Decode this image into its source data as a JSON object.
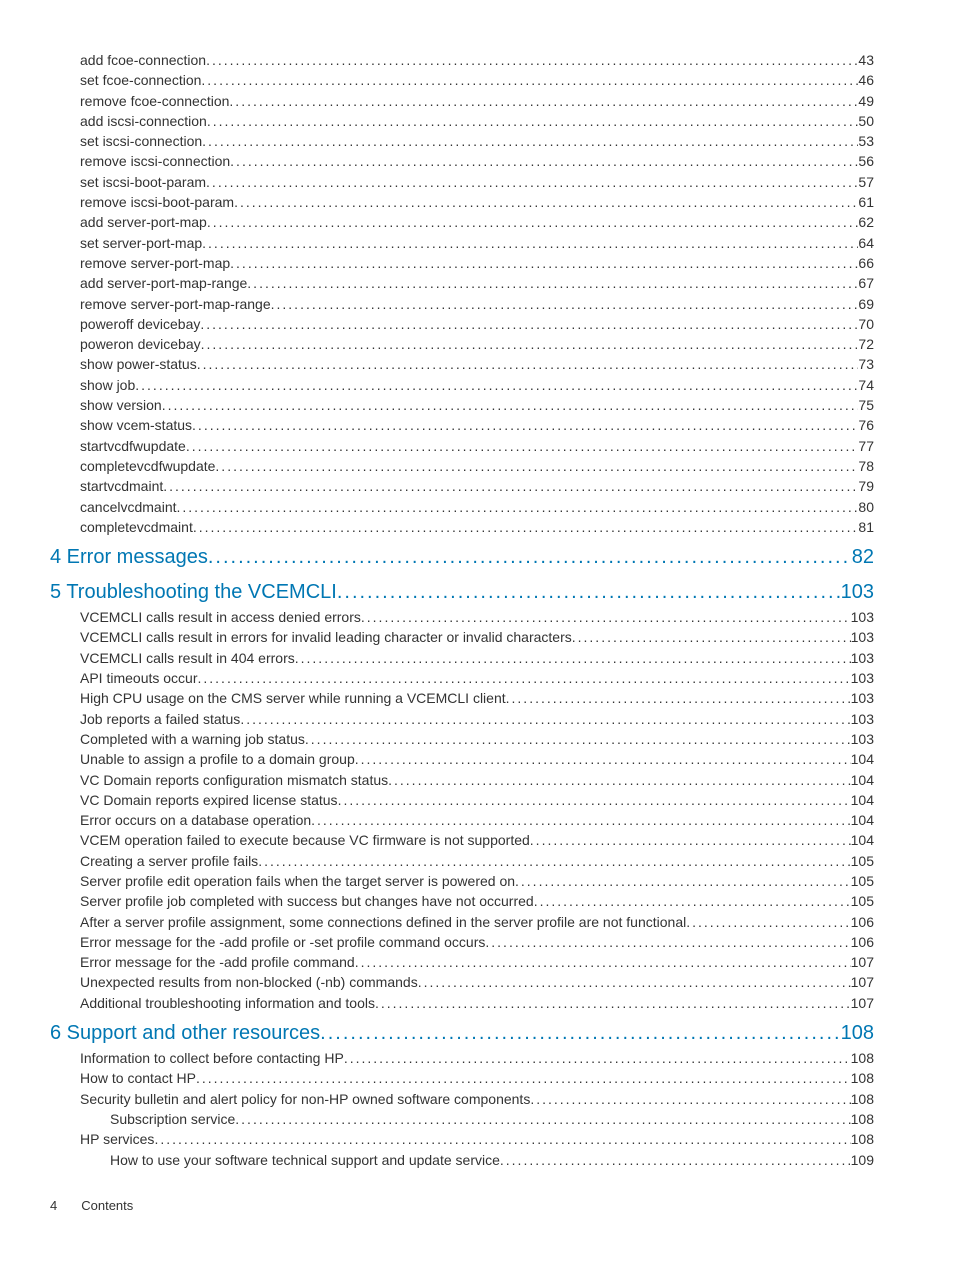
{
  "toc": [
    {
      "level": 1,
      "label": "add fcoe-connection",
      "page": "43"
    },
    {
      "level": 1,
      "label": "set fcoe-connection",
      "page": "46"
    },
    {
      "level": 1,
      "label": "remove fcoe-connection",
      "page": "49"
    },
    {
      "level": 1,
      "label": "add iscsi-connection",
      "page": "50"
    },
    {
      "level": 1,
      "label": "set iscsi-connection",
      "page": "53"
    },
    {
      "level": 1,
      "label": "remove iscsi-connection",
      "page": "56"
    },
    {
      "level": 1,
      "label": "set iscsi-boot-param",
      "page": "57"
    },
    {
      "level": 1,
      "label": "remove iscsi-boot-param",
      "page": "61"
    },
    {
      "level": 1,
      "label": "add server-port-map",
      "page": "62"
    },
    {
      "level": 1,
      "label": "set server-port-map",
      "page": "64"
    },
    {
      "level": 1,
      "label": "remove server-port-map",
      "page": "66"
    },
    {
      "level": 1,
      "label": "add server-port-map-range",
      "page": "67"
    },
    {
      "level": 1,
      "label": "remove server-port-map-range",
      "page": "69"
    },
    {
      "level": 1,
      "label": "poweroff devicebay",
      "page": "70"
    },
    {
      "level": 1,
      "label": "poweron devicebay",
      "page": "72"
    },
    {
      "level": 1,
      "label": "show power-status",
      "page": "73"
    },
    {
      "level": 1,
      "label": "show job",
      "page": "74"
    },
    {
      "level": 1,
      "label": "show version",
      "page": "75"
    },
    {
      "level": 1,
      "label": "show vcem-status",
      "page": "76"
    },
    {
      "level": 1,
      "label": "startvcdfwupdate",
      "page": "77"
    },
    {
      "level": 1,
      "label": "completevcdfwupdate",
      "page": "78"
    },
    {
      "level": 1,
      "label": "startvcdmaint",
      "page": "79"
    },
    {
      "level": 1,
      "label": "cancelvcdmaint",
      "page": "80"
    },
    {
      "level": 1,
      "label": "completevcdmaint",
      "page": "81"
    },
    {
      "level": 0,
      "label": "4 Error messages",
      "page": "82"
    },
    {
      "level": 0,
      "label": "5 Troubleshooting the VCEMCLI",
      "page": "103"
    },
    {
      "level": 1,
      "label": "VCEMCLI calls result in access denied errors",
      "page": "103"
    },
    {
      "level": 1,
      "label": "VCEMCLI calls result in errors for invalid leading character or invalid characters",
      "page": "103"
    },
    {
      "level": 1,
      "label": "VCEMCLI calls result in 404 errors",
      "page": "103"
    },
    {
      "level": 1,
      "label": "API timeouts occur",
      "page": "103"
    },
    {
      "level": 1,
      "label": "High CPU usage on the CMS server while running a VCEMCLI client",
      "page": "103"
    },
    {
      "level": 1,
      "label": "Job reports a failed status",
      "page": "103"
    },
    {
      "level": 1,
      "label": "Completed with a warning job status",
      "page": "103"
    },
    {
      "level": 1,
      "label": "Unable to assign a profile to a domain group",
      "page": "104"
    },
    {
      "level": 1,
      "label": "VC Domain reports configuration mismatch status",
      "page": "104"
    },
    {
      "level": 1,
      "label": "VC Domain reports expired license status",
      "page": "104"
    },
    {
      "level": 1,
      "label": "Error occurs on a database operation",
      "page": "104"
    },
    {
      "level": 1,
      "label": "VCEM operation failed to execute because VC firmware is not supported",
      "page": "104"
    },
    {
      "level": 1,
      "label": "Creating a server profile fails",
      "page": "105"
    },
    {
      "level": 1,
      "label": "Server profile edit operation fails when the target server is powered on",
      "page": "105"
    },
    {
      "level": 1,
      "label": "Server profile job completed with success but changes have not occurred",
      "page": "105"
    },
    {
      "level": 1,
      "label": "After a server profile assignment, some connections defined in the server profile are not functional",
      "page": "106"
    },
    {
      "level": 1,
      "label": "Error message for the -add profile or -set profile command occurs",
      "page": "106"
    },
    {
      "level": 1,
      "label": "Error message for the -add profile command",
      "page": "107"
    },
    {
      "level": 1,
      "label": "Unexpected results from non-blocked (-nb) commands",
      "page": "107"
    },
    {
      "level": 1,
      "label": "Additional troubleshooting information and tools",
      "page": "107"
    },
    {
      "level": 0,
      "label": "6 Support and other resources",
      "page": "108"
    },
    {
      "level": 1,
      "label": "Information to collect before contacting HP",
      "page": "108"
    },
    {
      "level": 1,
      "label": "How to contact HP",
      "page": "108"
    },
    {
      "level": 1,
      "label": "Security bulletin and alert policy for non-HP owned software components",
      "page": "108"
    },
    {
      "level": 2,
      "label": "Subscription service",
      "page": "108"
    },
    {
      "level": 1,
      "label": "HP services",
      "page": "108"
    },
    {
      "level": 2,
      "label": "How to use your software technical support and update service",
      "page": "109"
    }
  ],
  "footer": {
    "page_number": "4",
    "section": "Contents"
  }
}
